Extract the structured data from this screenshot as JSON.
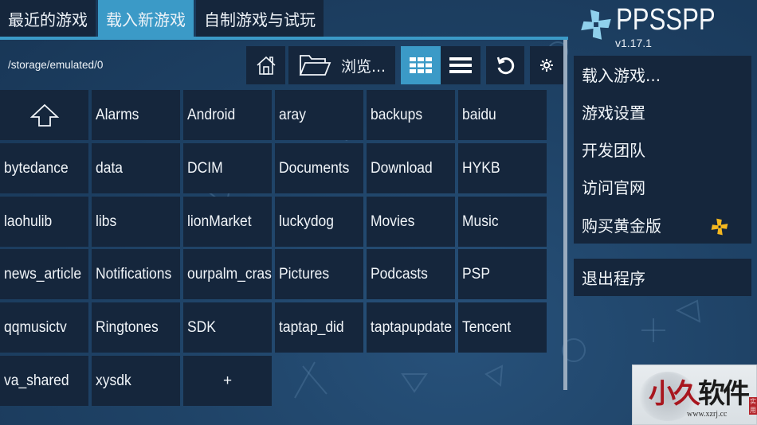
{
  "tabs": [
    {
      "label": "最近的游戏",
      "active": false
    },
    {
      "label": "载入新游戏",
      "active": true
    },
    {
      "label": "自制游戏与试玩",
      "active": false
    }
  ],
  "path": "/storage/emulated/0",
  "toolbar": {
    "home_icon": "home-icon",
    "browse_icon": "folder-open-icon",
    "browse_label": "浏览...",
    "grid_view_icon": "grid-view-icon",
    "grid_view_active": true,
    "list_view_icon": "list-view-icon",
    "refresh_icon": "refresh-icon",
    "settings_icon": "gear-icon"
  },
  "files": {
    "up_icon": "arrow-up-icon",
    "items": [
      "Alarms",
      "Android",
      "aray",
      "backups",
      "baidu",
      "bytedance",
      "data",
      "DCIM",
      "Documents",
      "Download",
      "HYKB",
      "laohulib",
      "libs",
      "lionMarket",
      "luckydog",
      "Movies",
      "Music",
      "news_article",
      "Notifications",
      "ourpalm_cras",
      "Pictures",
      "Podcasts",
      "PSP",
      "qqmusictv",
      "Ringtones",
      "SDK",
      "taptap_did",
      "taptapupdate",
      "Tencent",
      "va_shared",
      "xysdk"
    ],
    "add_label": "+"
  },
  "app": {
    "name": "PPSSPP",
    "version": "v1.17.1",
    "logo_color": "#8fd0ec",
    "accent": "#3b9ac7",
    "gold": "#f4b71f"
  },
  "menu": {
    "items": [
      "载入游戏...",
      "游戏设置",
      "开发团队",
      "访问官网",
      "购买黄金版"
    ],
    "exit_label": "退出程序"
  },
  "watermark": {
    "chars": [
      "小",
      "久",
      "软",
      "件"
    ],
    "url": "www.xzrj.cc",
    "seal": "实用"
  }
}
